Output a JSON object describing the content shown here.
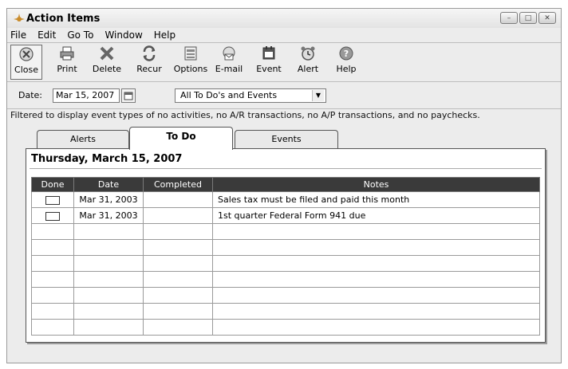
{
  "window": {
    "title": "Action Items"
  },
  "menu": [
    "File",
    "Edit",
    "Go To",
    "Window",
    "Help"
  ],
  "toolbar": [
    {
      "label": "Close",
      "icon": "close-icon"
    },
    {
      "label": "Print",
      "icon": "printer-icon"
    },
    {
      "label": "Delete",
      "icon": "delete-x-icon"
    },
    {
      "label": "Recur",
      "icon": "recur-icon"
    },
    {
      "label": "Options",
      "icon": "options-icon"
    },
    {
      "label": "E-mail",
      "icon": "email-icon"
    },
    {
      "label": "Event",
      "icon": "event-icon"
    },
    {
      "label": "Alert",
      "icon": "alert-clock-icon"
    },
    {
      "label": "Help",
      "icon": "help-icon"
    }
  ],
  "filter": {
    "date_label": "Date:",
    "date_value": "Mar 15, 2007",
    "view_value": "All To Do's and Events"
  },
  "notice": "Filtered to display event types of no activities, no A/R transactions, no A/P transactions, and no paychecks.",
  "tabs": [
    "Alerts",
    "To Do",
    "Events"
  ],
  "active_tab": "To Do",
  "panel": {
    "day_title": "Thursday, March 15, 2007",
    "columns": [
      "Done",
      "Date",
      "Completed",
      "Notes"
    ],
    "rows": [
      {
        "done": false,
        "date": "Mar 31, 2003",
        "completed": "",
        "notes": "Sales tax must be filed and paid this month"
      },
      {
        "done": false,
        "date": "Mar 31, 2003",
        "completed": "",
        "notes": "1st quarter Federal Form 941 due"
      }
    ],
    "empty_rows": 7
  }
}
